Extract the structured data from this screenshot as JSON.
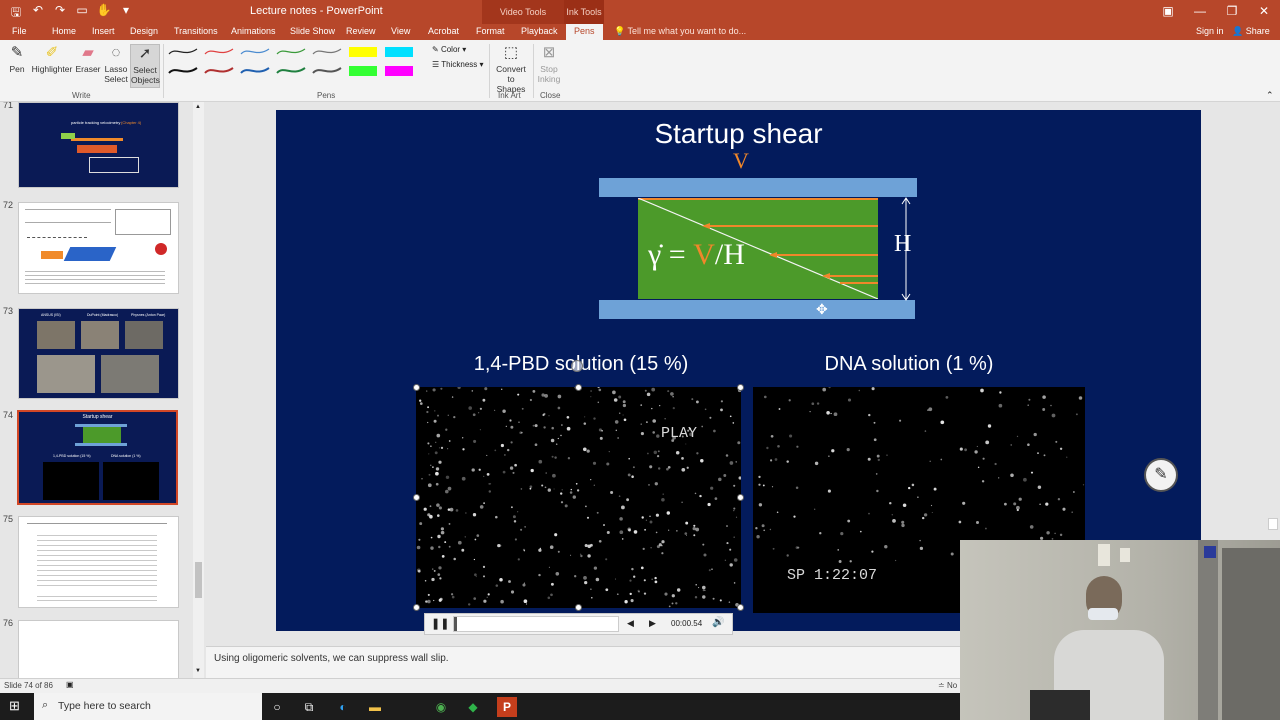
{
  "window": {
    "title": "Lecture notes - PowerPoint",
    "context_video": "Video Tools",
    "context_ink": "Ink Tools"
  },
  "tabs": [
    {
      "label": "File"
    },
    {
      "label": "Home"
    },
    {
      "label": "Insert"
    },
    {
      "label": "Design"
    },
    {
      "label": "Transitions"
    },
    {
      "label": "Animations"
    },
    {
      "label": "Slide Show"
    },
    {
      "label": "Review"
    },
    {
      "label": "View"
    },
    {
      "label": "Acrobat"
    },
    {
      "label": "Format"
    },
    {
      "label": "Playback"
    },
    {
      "label": "Pens"
    }
  ],
  "tell_me": "Tell me what you want to do...",
  "sign_in": "Sign in",
  "share": "Share",
  "ribbon": {
    "pen": "Pen",
    "highlighter": "Highlighter",
    "eraser": "Eraser",
    "lasso_1": "Lasso",
    "lasso_2": "Select",
    "select_1": "Select",
    "select_2": "Objects",
    "group_write": "Write",
    "group_pens": "Pens",
    "color": "Color",
    "thickness": "Thickness",
    "convert_1": "Convert",
    "convert_2": "to Shapes",
    "group_ink_art": "Ink Art",
    "stop_1": "Stop",
    "stop_2": "Inking",
    "group_close": "Close",
    "pen_colors": [
      "#222222",
      "#e04040",
      "#4a8bd0",
      "#3a9a3a",
      "#777777",
      "#ffff00",
      "#00e0ff",
      "#111111",
      "#b03030",
      "#2060b0",
      "#208040",
      "#555555",
      "#33ff33",
      "#ff00ff"
    ]
  },
  "thumbnails": {
    "numbers": [
      "71",
      "72",
      "73",
      "74",
      "75",
      "76"
    ],
    "slide71_title": "particle tracking velocimetry",
    "slide71_chapter": "(Chapter 4)",
    "slide74_title": "Startup shear",
    "slide74_left": "1,4-PBD solution (15 %)",
    "slide74_right": "DNA solution (1 %)",
    "slide73_labels": [
      "ANSUS (ISI)",
      "DuPoint (Madrasco)",
      "Physnes (Anton Paar)"
    ]
  },
  "slide": {
    "title": "Startup shear",
    "v_label": "V",
    "h_label": "H",
    "gamma_dot": "γ̇",
    "equals": "=",
    "gamma_v": "V",
    "gamma_rest": "/H",
    "left_label": "1,4-PBD solution (15 %)",
    "right_label": "DNA solution  (1 %)",
    "play_text": "PLAY",
    "sp_text": "SP   1:22:07"
  },
  "media": {
    "time": "00:00.54"
  },
  "notes": "Using oligomeric solvents, we can suppress wall slip.",
  "status": {
    "slide_counter": "Slide 74 of 86",
    "notes_label": "No"
  },
  "taskbar": {
    "search_placeholder": "Type here to search"
  }
}
